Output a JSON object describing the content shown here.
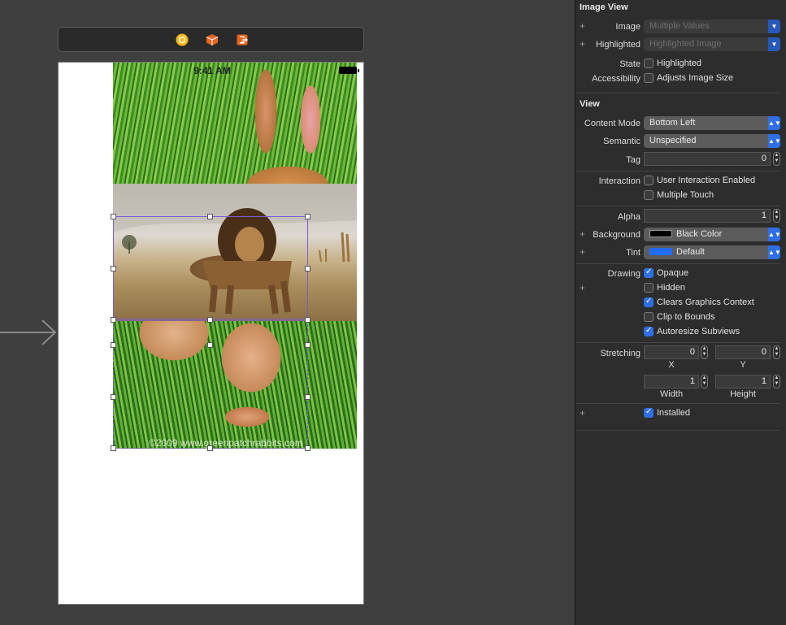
{
  "canvas": {
    "status_time": "9:41 AM",
    "watermark": "©2009 www.greenpatchrabbits.com",
    "scene_icons": [
      "view-controller-icon",
      "first-responder-icon",
      "exit-icon"
    ]
  },
  "inspector": {
    "image_view": {
      "title": "Image View",
      "image_label": "Image",
      "image_placeholder": "Multiple Values",
      "highlighted_label": "Highlighted",
      "highlighted_placeholder": "Highlighted Image",
      "state_label": "State",
      "state_option": "Highlighted",
      "accessibility_label": "Accessibility",
      "accessibility_option": "Adjusts Image Size"
    },
    "view": {
      "title": "View",
      "content_mode_label": "Content Mode",
      "content_mode_value": "Bottom Left",
      "semantic_label": "Semantic",
      "semantic_value": "Unspecified",
      "tag_label": "Tag",
      "tag_value": "0",
      "interaction_label": "Interaction",
      "user_interaction": "User Interaction Enabled",
      "multiple_touch": "Multiple Touch",
      "alpha_label": "Alpha",
      "alpha_value": "1",
      "background_label": "Background",
      "background_value": "Black Color",
      "background_color": "#000000",
      "tint_label": "Tint",
      "tint_value": "Default",
      "tint_color": "#1f6cf0",
      "drawing_label": "Drawing",
      "opaque": "Opaque",
      "hidden": "Hidden",
      "clears_graphics": "Clears Graphics Context",
      "clip_bounds": "Clip to Bounds",
      "autoresize": "Autoresize Subviews",
      "stretching_label": "Stretching",
      "stretch_x": "0",
      "stretch_y": "0",
      "stretch_width": "1",
      "stretch_height": "1",
      "x_label": "X",
      "y_label": "Y",
      "width_label": "Width",
      "height_label": "Height",
      "installed": "Installed"
    }
  }
}
